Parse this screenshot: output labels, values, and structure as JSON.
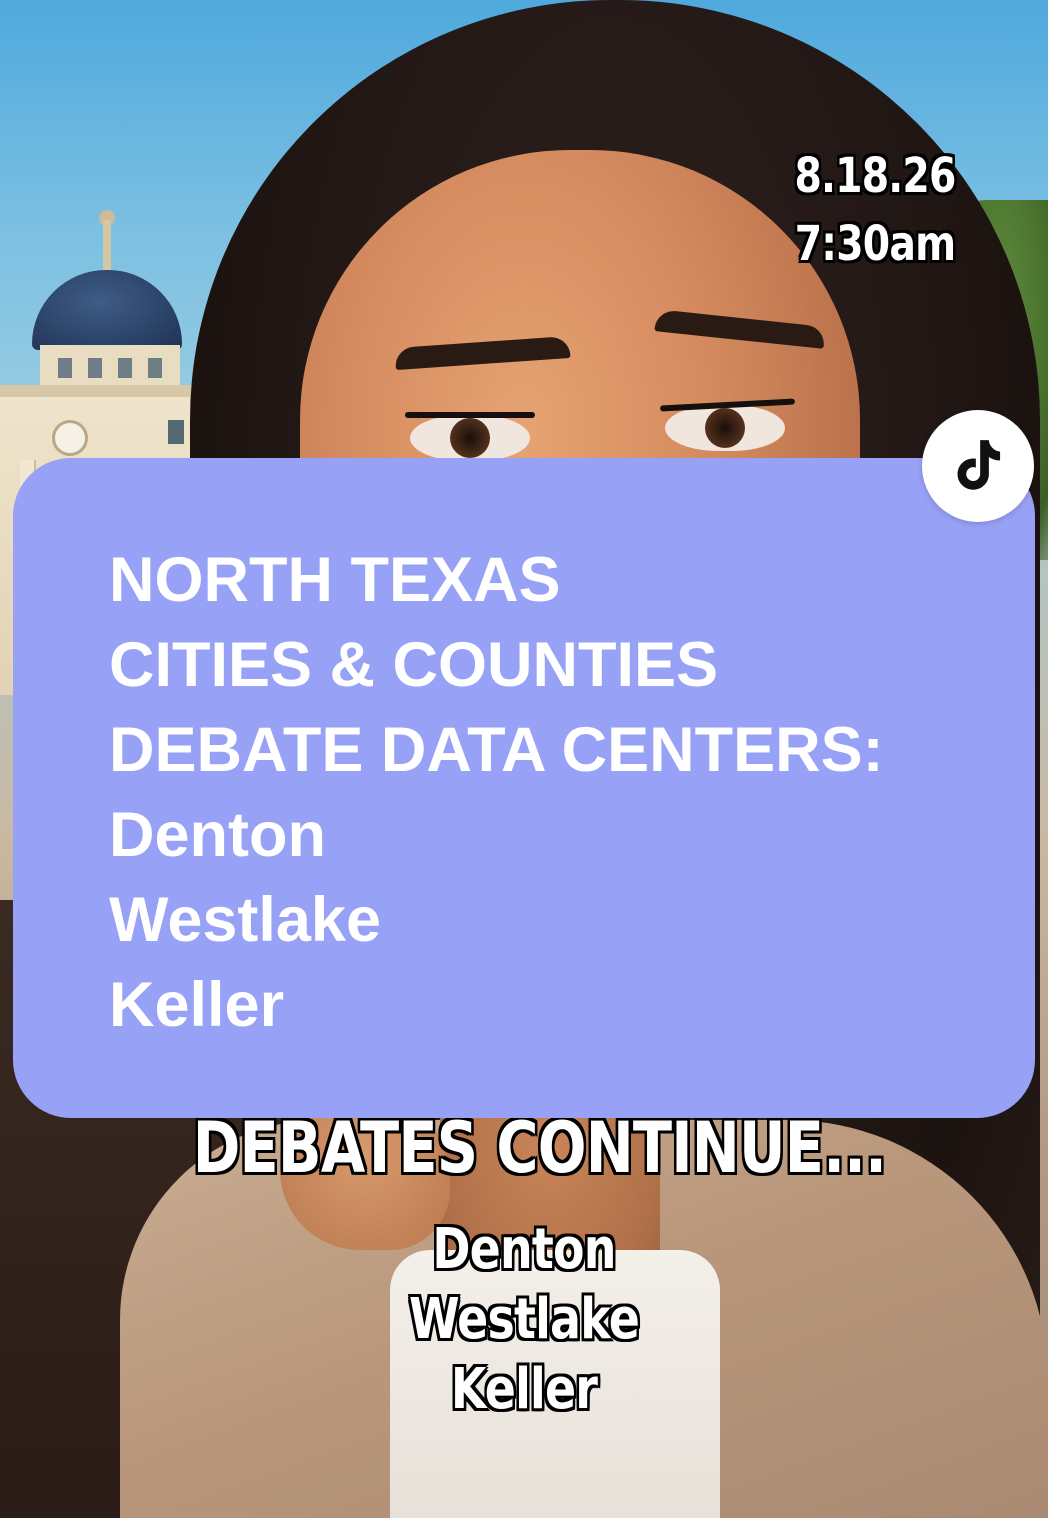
{
  "overlay": {
    "date": "8.18.26",
    "time": "7:30am",
    "caption_continue": "DEBATES CONTINUE...",
    "caption_cities": [
      "Denton",
      "Westlake",
      "Keller"
    ]
  },
  "card": {
    "lines": [
      "NORTH TEXAS",
      "CITIES & COUNTIES",
      "DEBATE DATA CENTERS:",
      "Denton",
      "Westlake",
      "Keller"
    ],
    "background_color": "#97a1f5",
    "text_color": "#ffffff"
  },
  "badge": {
    "icon": "tiktok-logo-icon"
  }
}
